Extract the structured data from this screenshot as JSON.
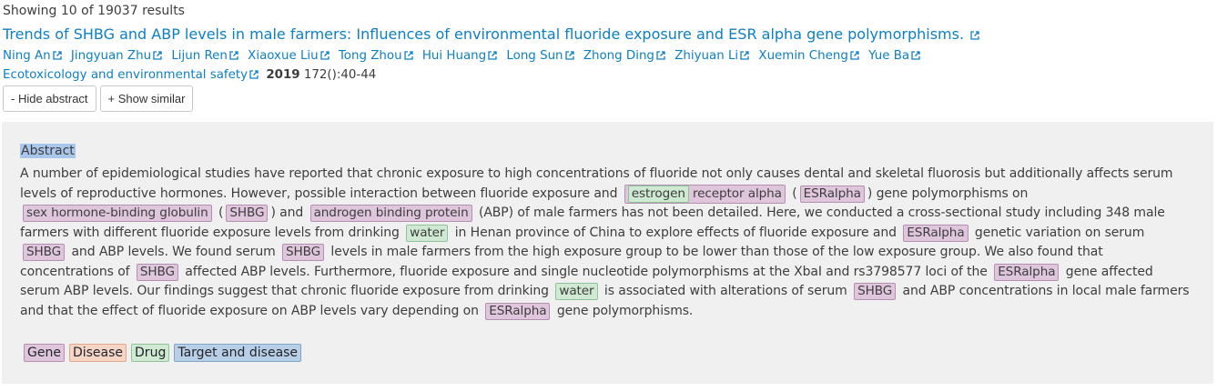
{
  "results": {
    "text": "Showing 10 of 19037 results"
  },
  "article": {
    "title": "Trends of SHBG and ABP levels in male farmers: Influences of environmental fluoride exposure and ESR alpha gene polymorphisms.",
    "authors": [
      "Ning An",
      "Jingyuan Zhu",
      "Lijun Ren",
      "Xiaoxue Liu",
      "Tong Zhou",
      "Hui Huang",
      "Long Sun",
      "Zhong Ding",
      "Zhiyuan Li",
      "Xuemin Cheng",
      "Yue Ba"
    ],
    "journal": "Ecotoxicology and environmental safety",
    "year": "2019",
    "citation": "172():40-44"
  },
  "buttons": {
    "hide_abstract": "- Hide abstract",
    "show_similar": "+ Show similar"
  },
  "abstract": {
    "heading": "Abstract",
    "t1": "A number of epidemiological studies have reported that chronic exposure to high concentrations of fluoride not only causes dental and skeletal fluorosis but additionally affects serum levels of reproductive hormones. However, possible interaction between fluoride exposure and",
    "tag_estrogen_receptor": "estrogen",
    "t2a": "receptor alpha",
    "tag_esr1": "ESRalpha",
    "t3": ") gene polymorphisms on",
    "tag_shbg_full": "sex hormone-binding globulin",
    "tag_shbg1": "SHBG",
    "t4": ") and",
    "tag_abp_full": "androgen binding protein",
    "t5": "(ABP) of male farmers has not been detailed. Here, we conducted a cross-sectional study including 348 male farmers with different fluoride exposure levels from drinking",
    "tag_water1": "water",
    "t6": "in Henan province of China to explore effects of fluoride exposure and",
    "tag_esr2": "ESRalpha",
    "t7": "genetic variation on serum",
    "tag_shbg2": "SHBG",
    "t8": "and ABP levels. We found serum",
    "tag_shbg3": "SHBG",
    "t9": "levels in male farmers from the high exposure group to be lower than those of the low exposure group. We also found that concentrations of",
    "tag_shbg4": "SHBG",
    "t10": "affected ABP levels. Furthermore, fluoride exposure and single nucleotide polymorphisms at the XbaI and rs3798577 loci of the",
    "tag_esr3": "ESRalpha",
    "t11": "gene affected serum ABP levels. Our findings suggest that chronic fluoride exposure from drinking",
    "tag_water2": "water",
    "t12": "is associated with alterations of serum",
    "tag_shbg5": "SHBG",
    "t13": "and ABP concentrations in local male farmers and that the effect of fluoride exposure on ABP levels vary depending on",
    "tag_esr4": "ESRalpha",
    "t14": "gene polymorphisms."
  },
  "legend": {
    "gene": "Gene",
    "disease": "Disease",
    "drug": "Drug",
    "target": "Target and disease"
  },
  "colors": {
    "link": "#0d7fc4",
    "gene": "#dfc6dc",
    "drug": "#cfe9d2",
    "disease": "#f6d5c6",
    "target": "#b9cfe8"
  }
}
